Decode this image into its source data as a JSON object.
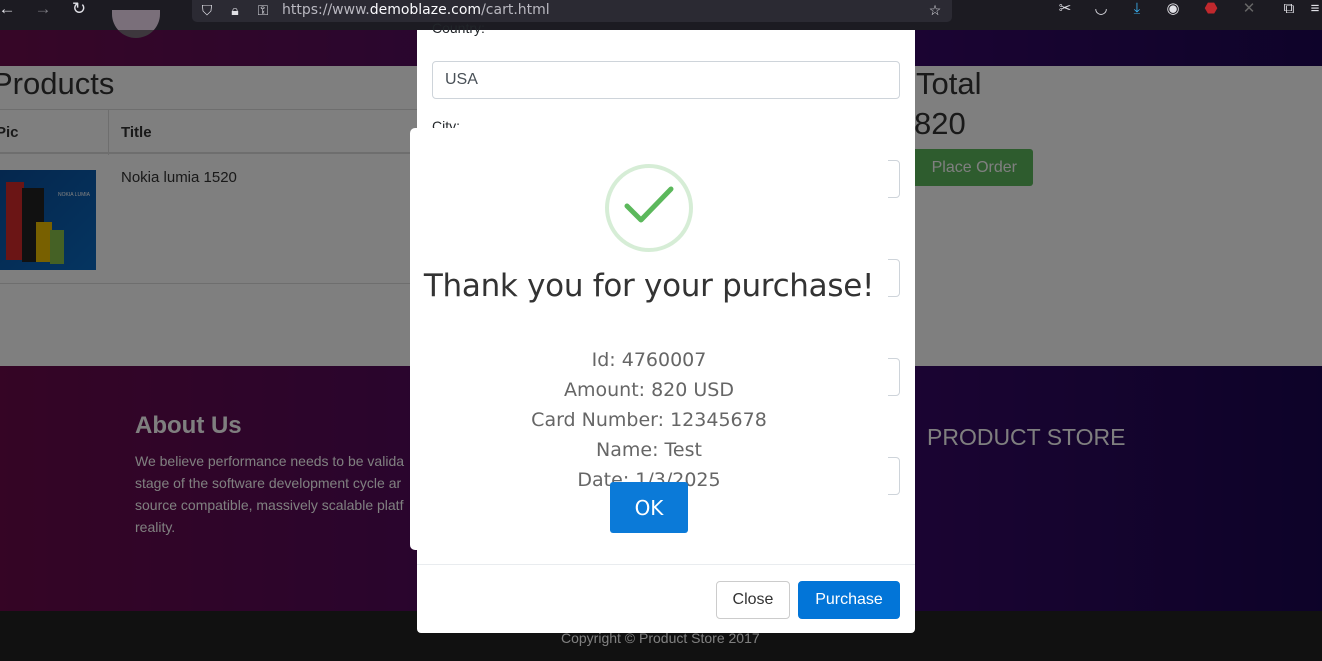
{
  "browser": {
    "url_prefix": "https://www.",
    "url_domain": "demoblaze.com",
    "url_path": "/cart.html"
  },
  "page": {
    "products_heading": "Products",
    "total_heading": "Total",
    "total_value": "820",
    "place_order_label": "Place Order",
    "table": {
      "headers": [
        "Pic",
        "Title"
      ],
      "rows": [
        {
          "title": "Nokia lumia 1520"
        }
      ]
    },
    "about": {
      "heading": "About Us",
      "lines": [
        "We believe performance needs to be valida",
        "stage of the software development cycle ar",
        "source compatible, massively scalable platf",
        "reality."
      ]
    },
    "store_heading": "PRODUCT STORE",
    "copyright": "Copyright © Product Store 2017"
  },
  "order_modal": {
    "country_label": "Country:",
    "country_value": "USA",
    "city_label": "City:",
    "close_label": "Close",
    "purchase_label": "Purchase"
  },
  "alert": {
    "title": "Thank you for your purchase!",
    "lines": [
      "Id: 4760007",
      "Amount: 820 USD",
      "Card Number: 12345678",
      "Name: Test",
      "Date: 1/3/2025"
    ],
    "ok_label": "OK",
    "icon": "checkmark-icon",
    "accent_color": "#5cb85c"
  }
}
